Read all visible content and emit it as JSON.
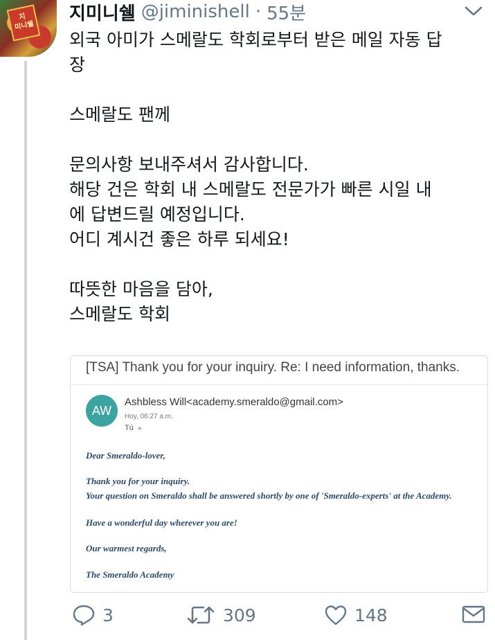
{
  "tweet": {
    "display_name": "지미니쉘",
    "handle": "@jiminishell",
    "separator": "·",
    "time": "55분",
    "avatar_text": "지\n미니쉘",
    "text_lines": [
      "외국 아미가 스메랄도 학회로부터 받은 메일 자동 답",
      "장",
      "",
      "스메랄도 팬께",
      "",
      "문의사항 보내주셔서 감사합니다.",
      "해당 건은 학회 내 스메랄도 전문가가 빠른 시일 내",
      "에 답변드릴 예정입니다.",
      "어디 계시건 좋은 하루 되세요!",
      "",
      "따뜻한 마음을 담아,",
      "스메랄도 학회"
    ]
  },
  "email": {
    "subject": "[TSA] Thank you for your inquiry. Re: I need information, thanks.",
    "avatar_initials": "AW",
    "sender": "Ashbless Will<academy.smeraldo@gmail.com>",
    "date": "Hoy, 06:27 a.m.",
    "to": "Tú",
    "to_chevron": "»",
    "body": [
      "Dear Smeraldo-lover,",
      "Thank you for your inquiry.",
      "Your question on Smeraldo shall be answered shortly by one of 'Smeraldo-experts' at the Academy.",
      "Have a wonderful day wherever you are!",
      "Our warmest regards,",
      "The Smeraldo Academy"
    ]
  },
  "actions": {
    "reply_count": "3",
    "retweet_count": "309",
    "like_count": "148"
  },
  "colors": {
    "text": "#14171a",
    "muted": "#657786",
    "thread_line": "#ccd6dd",
    "email_avatar": "#3ba3a0",
    "email_body": "#2b4a6b"
  },
  "icons": [
    "chevron-down-icon",
    "reply-icon",
    "retweet-icon",
    "like-icon",
    "share-mail-icon",
    "email-to-chevron-icon"
  ]
}
